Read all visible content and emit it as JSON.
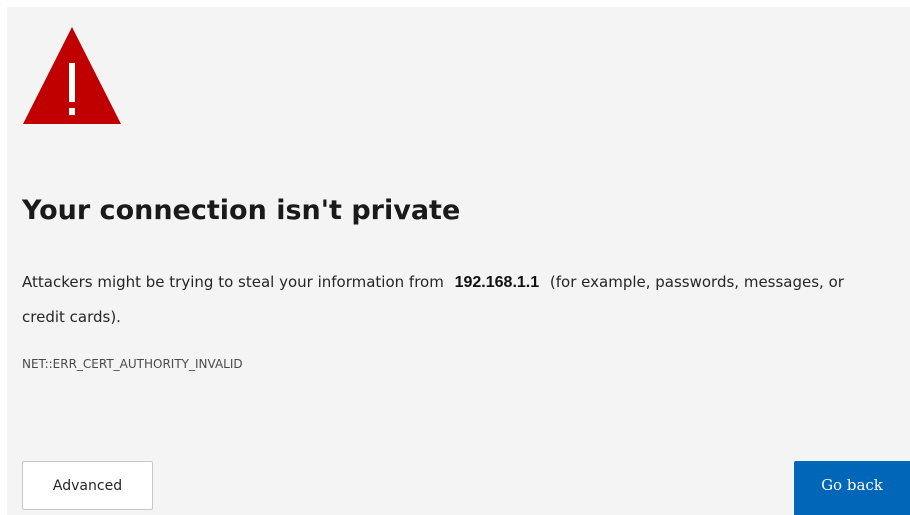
{
  "page": {
    "title": "Your connection isn't private",
    "message_before_host": "Attackers might be trying to steal your information from",
    "host": "192.168.1.1",
    "message_after_host": "(for example, passwords, messages, or credit cards).",
    "error_code": "NET::ERR_CERT_AUTHORITY_INVALID"
  },
  "buttons": {
    "advanced_label": "Advanced",
    "back_label": "Go back"
  },
  "icon": {
    "name": "warning-triangle-icon",
    "color": "#c00000"
  },
  "colors": {
    "background": "#f4f4f4",
    "primary_button": "#0067b8"
  }
}
